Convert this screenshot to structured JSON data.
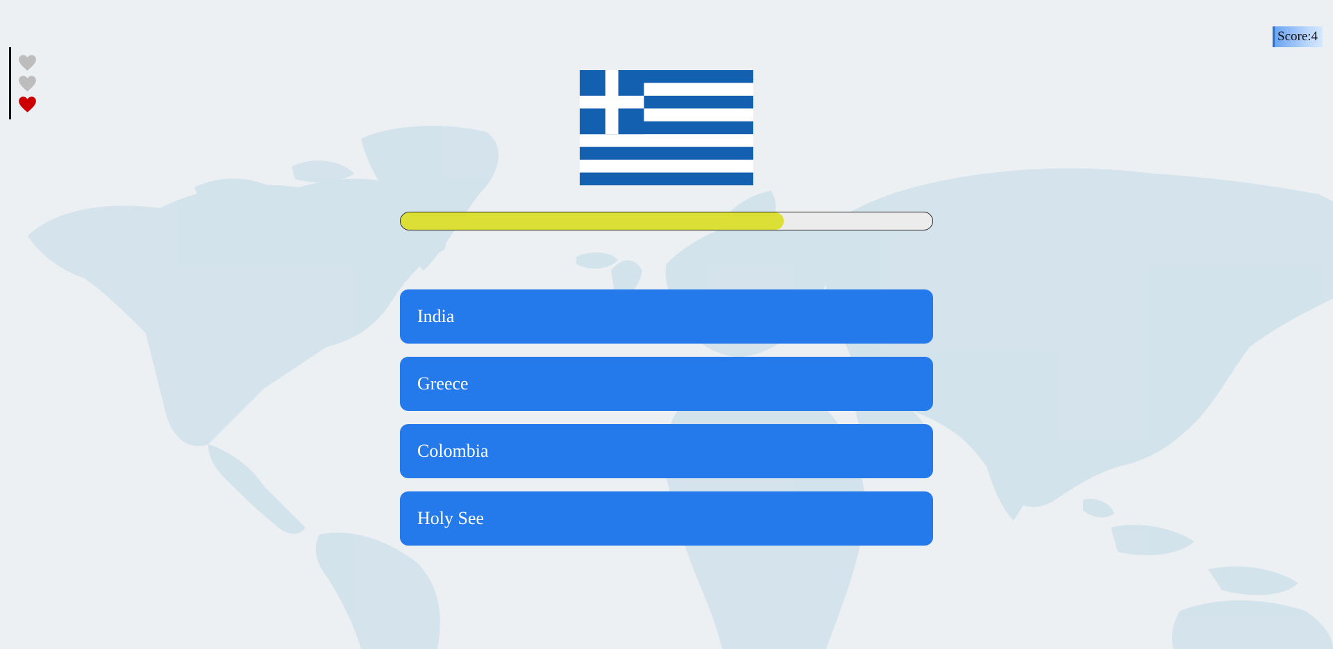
{
  "score": {
    "label": "Score:4"
  },
  "lives": {
    "total": 3,
    "remaining": 1,
    "lost_color": "#bdbdbd",
    "remaining_color": "#cc0000"
  },
  "timer": {
    "progress": 0.72,
    "fill_color": "#dbdf36"
  },
  "flag": {
    "icon": "greece-flag",
    "blue": "#1460b0",
    "white": "#ffffff"
  },
  "answers": [
    {
      "label": "India"
    },
    {
      "label": "Greece"
    },
    {
      "label": "Colombia"
    },
    {
      "label": "Holy See"
    }
  ],
  "colors": {
    "background": "#edf0f3",
    "map": "#cfe1ea",
    "button": "#2479eb"
  }
}
